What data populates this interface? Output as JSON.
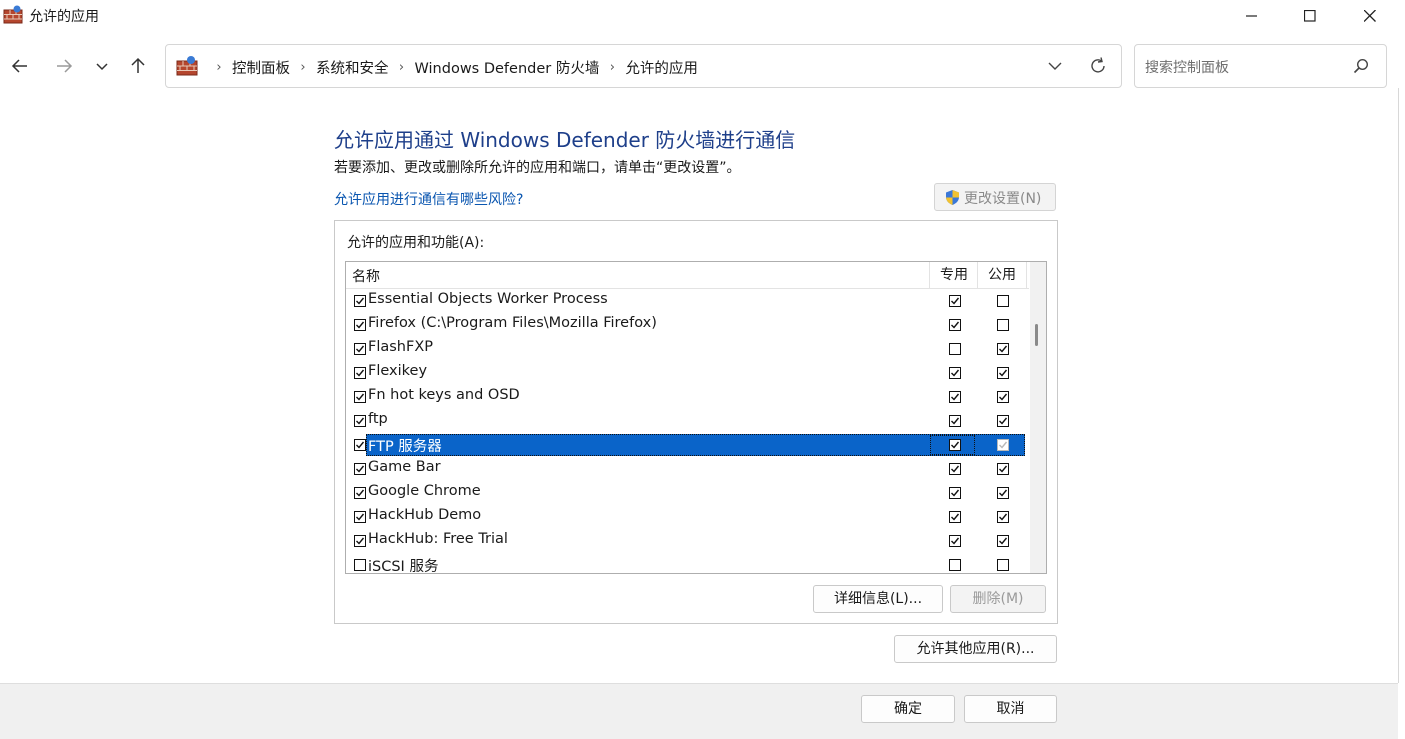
{
  "window": {
    "title": "允许的应用"
  },
  "address_bar": {
    "breadcrumbs": [
      "控制面板",
      "系统和安全",
      "Windows Defender 防火墙",
      "允许的应用"
    ]
  },
  "search": {
    "placeholder": "搜索控制面板"
  },
  "content": {
    "heading": "允许应用通过 Windows Defender 防火墙进行通信",
    "description": "若要添加、更改或删除所允许的应用和端口，请单击“更改设置”。",
    "risk_link": "允许应用进行通信有哪些风险?",
    "change_settings_label": "更改设置(N)",
    "group_label": "允许的应用和功能(A):"
  },
  "list": {
    "columns": {
      "name": "名称",
      "private": "专用",
      "public": "公用"
    },
    "rows": [
      {
        "name": "Essential Objects Worker Process",
        "enabled": true,
        "private": true,
        "public": false,
        "selected": false
      },
      {
        "name": "Firefox (C:\\Program Files\\Mozilla Firefox)",
        "enabled": true,
        "private": true,
        "public": false,
        "selected": false
      },
      {
        "name": "FlashFXP",
        "enabled": true,
        "private": false,
        "public": true,
        "selected": false
      },
      {
        "name": "Flexikey",
        "enabled": true,
        "private": true,
        "public": true,
        "selected": false
      },
      {
        "name": "Fn hot keys and OSD",
        "enabled": true,
        "private": true,
        "public": true,
        "selected": false
      },
      {
        "name": "ftp",
        "enabled": true,
        "private": true,
        "public": true,
        "selected": false
      },
      {
        "name": "FTP 服务器",
        "enabled": true,
        "private": true,
        "public": true,
        "selected": true
      },
      {
        "name": "Game Bar",
        "enabled": true,
        "private": true,
        "public": true,
        "selected": false
      },
      {
        "name": "Google Chrome",
        "enabled": true,
        "private": true,
        "public": true,
        "selected": false
      },
      {
        "name": "HackHub Demo",
        "enabled": true,
        "private": true,
        "public": true,
        "selected": false
      },
      {
        "name": "HackHub: Free Trial",
        "enabled": true,
        "private": true,
        "public": true,
        "selected": false
      },
      {
        "name": "iSCSI 服务",
        "enabled": false,
        "private": false,
        "public": false,
        "selected": false
      }
    ]
  },
  "buttons": {
    "details": "详细信息(L)...",
    "remove": "删除(M)",
    "allow_other": "允许其他应用(R)...",
    "ok": "确定",
    "cancel": "取消"
  },
  "colors": {
    "heading": "#1e3f8a",
    "link": "#0a56b0",
    "selection": "#0a64c9"
  }
}
